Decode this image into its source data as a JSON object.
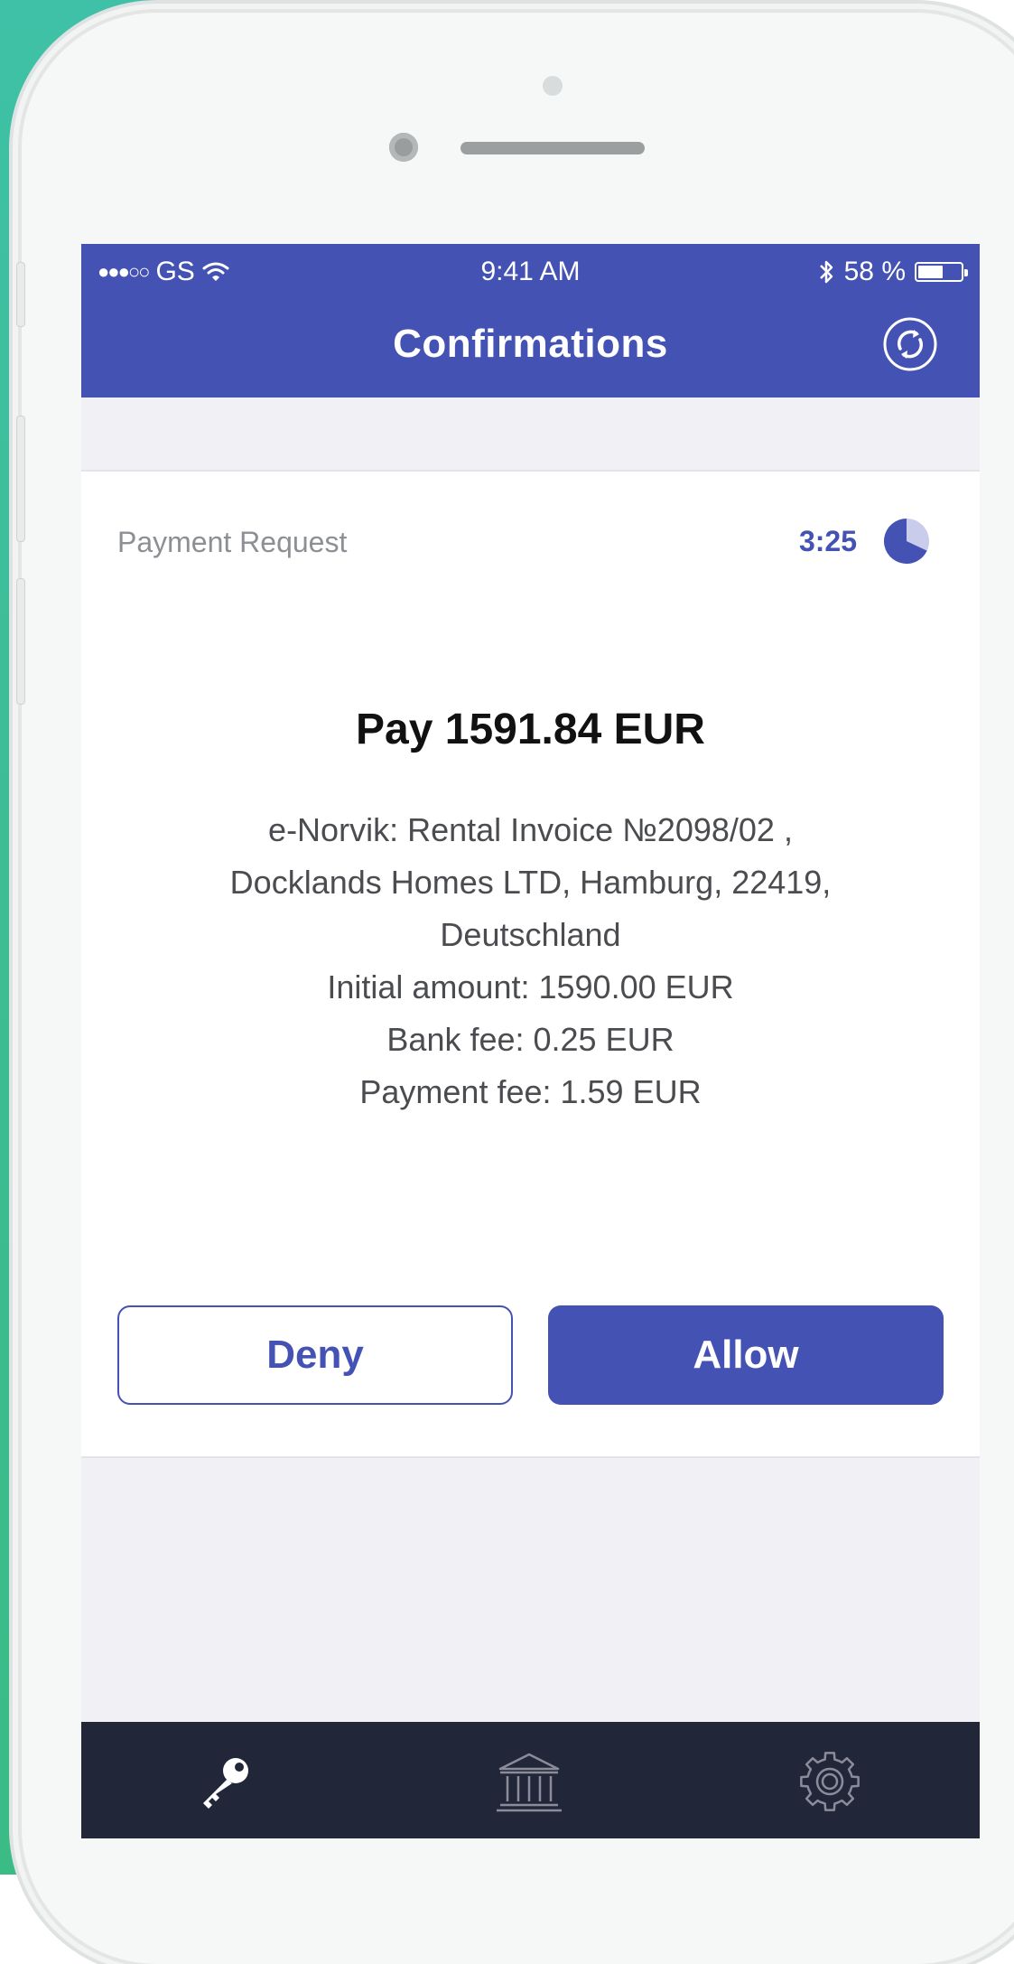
{
  "status_bar": {
    "carrier": "GS",
    "signal_dots": "●●●○○",
    "time": "9:41 AM",
    "battery_percent": "58 %",
    "battery_level": 0.58
  },
  "header": {
    "title": "Confirmations",
    "refresh_icon": "refresh-icon"
  },
  "request": {
    "label": "Payment Request",
    "timer": "3:25",
    "timer_remaining_fraction": 0.68,
    "title": "Pay 1591.84 EUR",
    "details": [
      "e-Norvik: Rental Invoice №2098/02 ,",
      "Docklands Homes LTD, Hamburg, 22419,",
      "Deutschland",
      "Initial amount: 1590.00 EUR",
      "Bank fee: 0.25 EUR",
      "Payment fee: 1.59 EUR"
    ]
  },
  "actions": {
    "deny_label": "Deny",
    "allow_label": "Allow"
  },
  "tabbar": {
    "items": [
      {
        "icon": "key-icon",
        "active": true
      },
      {
        "icon": "bank-icon",
        "active": false
      },
      {
        "icon": "gear-icon",
        "active": false
      }
    ]
  },
  "colors": {
    "accent": "#4452b4",
    "tabbar_bg": "#222639",
    "background_teal": "#3ec1a6"
  }
}
